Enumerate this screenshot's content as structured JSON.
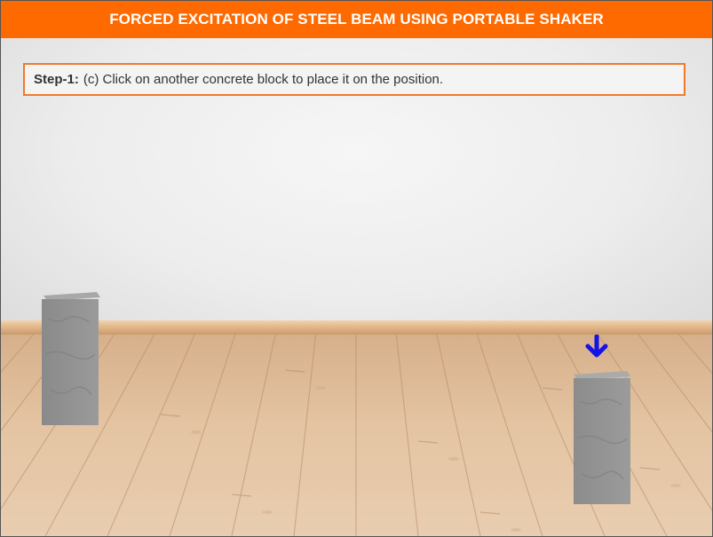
{
  "header": {
    "title": "FORCED EXCITATION OF STEEL BEAM USING PORTABLE SHAKER"
  },
  "instruction": {
    "step_label": "Step-1:",
    "text": "(c) Click on another concrete block to place it on the position."
  },
  "scene": {
    "blocks": [
      {
        "name": "placed-concrete-block",
        "state": "placed"
      },
      {
        "name": "concrete-block-to-place",
        "state": "highlighted"
      }
    ],
    "indicator_icon": "arrow-down-icon",
    "indicator_color": "#1414e6",
    "accent_color": "#ff6a00"
  }
}
